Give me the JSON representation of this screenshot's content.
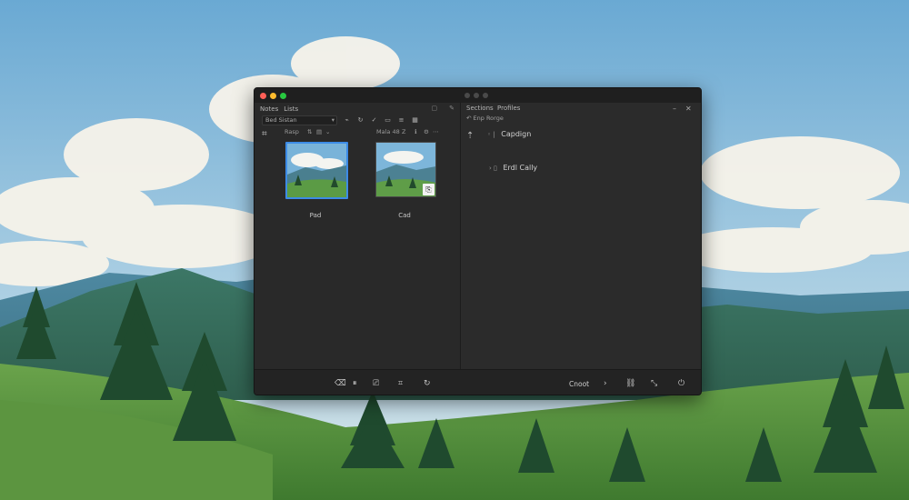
{
  "window": {
    "left_tabs": [
      "Notes",
      "Lists"
    ],
    "toolbar_select": "Bed Sistan",
    "left_sub": [
      "Rasp",
      "Mala 48",
      "Z"
    ],
    "thumbs": [
      {
        "label": "Pad",
        "selected": true
      },
      {
        "label": "Cad",
        "selected": false
      }
    ],
    "right_tabs": [
      "Sections",
      "Profiles"
    ],
    "right_sub": "Enp Rorge",
    "tree": [
      {
        "label": "Capdign"
      },
      {
        "label": "Erdl Cally"
      }
    ],
    "footer_cancel": "Cnoot",
    "icons": {
      "left_side": "folder-icon",
      "right_side": "pin-icon"
    }
  },
  "colors": {
    "accent": "#3d8be6",
    "window_bg": "#2a2a2a",
    "title_bg": "#1f1f1f"
  }
}
